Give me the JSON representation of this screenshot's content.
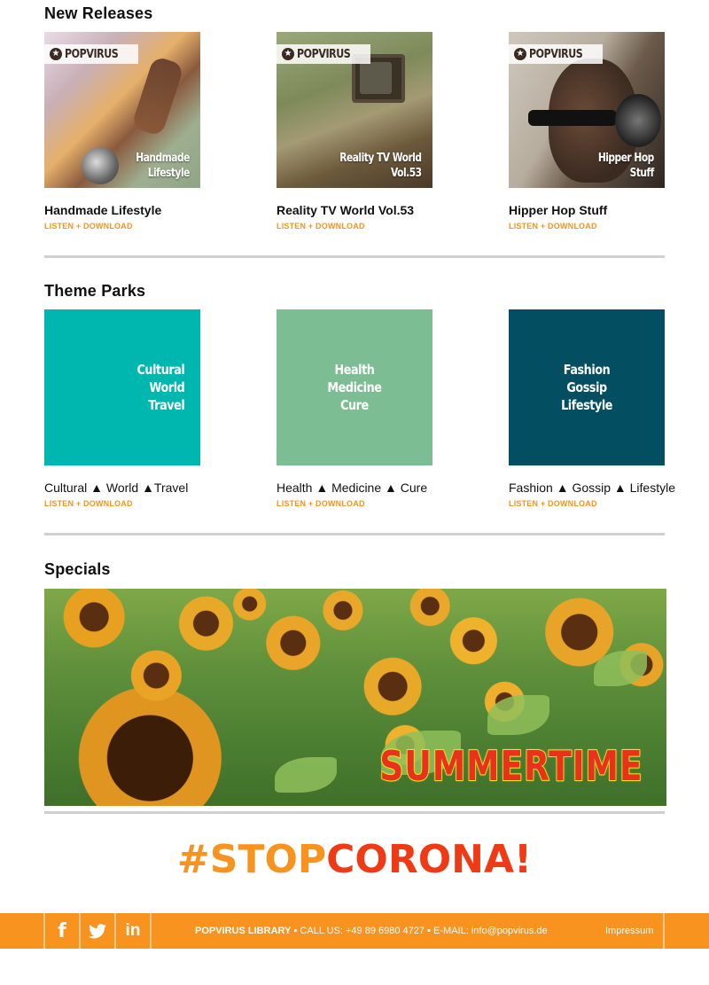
{
  "sections": {
    "new_releases": {
      "title": "New Releases",
      "items": [
        {
          "title": "Handmade Lifestyle",
          "art_brand": "POPVIRUS",
          "art_caption": [
            "Handmade",
            "Lifestyle"
          ],
          "link": "LISTEN + DOWNLOAD"
        },
        {
          "title": "Reality TV World Vol.53",
          "art_brand": "POPVIRUS",
          "art_caption": [
            "Reality TV World",
            "Vol.53"
          ],
          "link": "LISTEN + DOWNLOAD"
        },
        {
          "title": "Hipper Hop Stuff",
          "art_brand": "POPVIRUS",
          "art_caption": [
            "Hipper Hop",
            "Stuff"
          ],
          "link": "LISTEN + DOWNLOAD"
        }
      ]
    },
    "theme_parks": {
      "title": "Theme Parks",
      "items": [
        {
          "title": "Cultural ▲ World ▲Travel",
          "tile_lines": [
            "Cultural",
            "World",
            "Travel"
          ],
          "tile_color": "#00b7b0",
          "link": "LISTEN + DOWNLOAD"
        },
        {
          "title": "Health ▲ Medicine ▲ Cure",
          "tile_lines": [
            "Health",
            "Medicine",
            "Cure"
          ],
          "tile_color": "#7dbd93",
          "link": "LISTEN + DOWNLOAD"
        },
        {
          "title": "Fashion ▲ Gossip ▲ Lifestyle",
          "tile_lines": [
            "Fashion",
            "Gossip",
            "Lifestyle"
          ],
          "tile_color": "#034f61",
          "link": "LISTEN + DOWNLOAD"
        }
      ]
    },
    "specials": {
      "title": "Specials",
      "banner_text": "SUMMERTIME"
    }
  },
  "campaign": {
    "part1": "#STOP",
    "part2": "CORONA!"
  },
  "footer": {
    "social": [
      {
        "name": "facebook",
        "glyph": "f"
      },
      {
        "name": "twitter",
        "glyph": "🐦"
      },
      {
        "name": "linkedin",
        "glyph": "in"
      }
    ],
    "company": "POPVIRUS LIBRARY",
    "bullet": "▪",
    "call_label": "CALL US:",
    "phone": "+49 89 6980 4727",
    "email_label": "E-MAIL:",
    "email": "info@popvirus.de",
    "impressum": "Impressum"
  },
  "colors": {
    "accent": "#f7931e",
    "corona_red": "#ef3b15",
    "divider": "#d0d0d0"
  }
}
